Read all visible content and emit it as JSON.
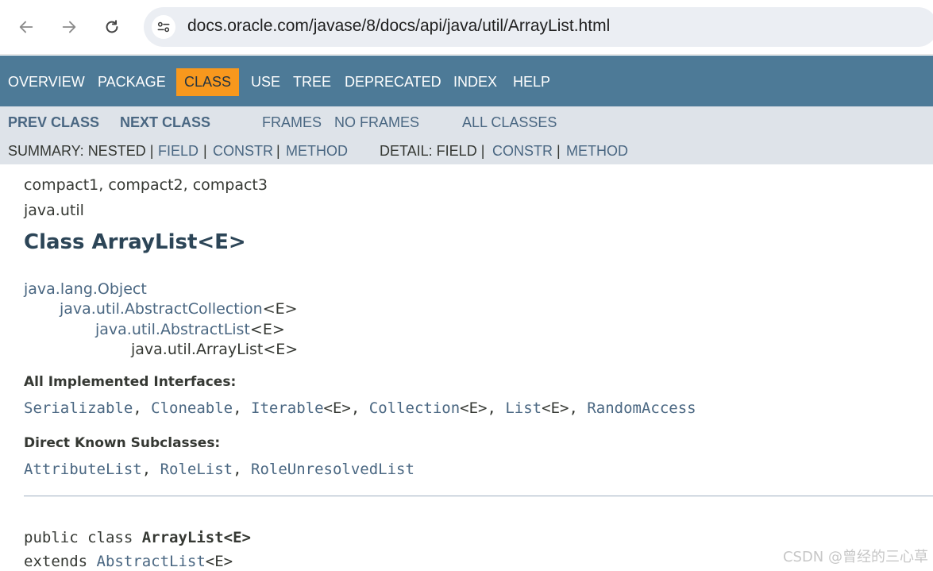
{
  "browser": {
    "url": "docs.oracle.com/javase/8/docs/api/java/util/ArrayList.html",
    "icons": [
      "back-arrow-icon",
      "forward-arrow-icon",
      "reload-icon",
      "site-settings-icon"
    ]
  },
  "topnav": {
    "items": [
      "OVERVIEW",
      "PACKAGE",
      "CLASS",
      "USE",
      "TREE",
      "DEPRECATED",
      "INDEX",
      "HELP"
    ],
    "active": "CLASS"
  },
  "subnav": {
    "prev_class": "PREV CLASS",
    "next_class": "NEXT CLASS",
    "frames": "FRAMES",
    "no_frames": "NO FRAMES",
    "all_classes": "ALL CLASSES",
    "summary_label": "SUMMARY: NESTED |",
    "summary_field": "FIELD",
    "summary_constr": "CONSTR",
    "summary_method": "METHOD",
    "detail_label": "DETAIL: FIELD |",
    "detail_constr": "CONSTR",
    "detail_method": "METHOD",
    "separator": "|"
  },
  "content": {
    "profiles": "compact1, compact2, compact3",
    "package": "java.util",
    "title": "Class ArrayList<E>",
    "hierarchy": {
      "level0": "java.lang.Object",
      "level1_link": "java.util.AbstractCollection",
      "level1_suffix": "<E>",
      "level2_link": "java.util.AbstractList",
      "level2_suffix": "<E>",
      "level3": "java.util.ArrayList<E>"
    },
    "interfaces_header": "All Implemented Interfaces:",
    "interfaces": {
      "serializable": "Serializable",
      "cloneable": "Cloneable",
      "iterable": "Iterable",
      "collection": "Collection",
      "list": "List",
      "random_access": "RandomAccess",
      "generic": "<E>",
      "comma": ", "
    },
    "subclasses_header": "Direct Known Subclasses:",
    "subclasses": {
      "attribute_list": "AttributeList",
      "role_list": "RoleList",
      "role_unresolved_list": "RoleUnresolvedList",
      "comma": ", "
    },
    "declaration": {
      "prefix": "public class ",
      "name": "ArrayList<E>",
      "extends_kw": "extends ",
      "extends_link": "AbstractList",
      "extends_suffix": "<E>"
    }
  },
  "watermark": "CSDN @曾经的三心草",
  "colors": {
    "topnav_bg": "#4d7a97",
    "active_tab_bg": "#f8981d",
    "subnav_bg": "#dee3e9",
    "link": "#4a6782",
    "text": "#353833"
  }
}
